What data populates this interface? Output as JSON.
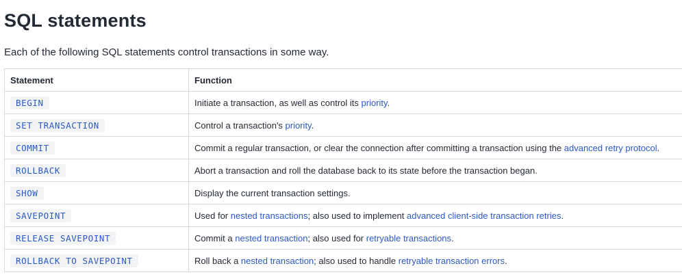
{
  "title": "SQL statements",
  "intro": "Each of the following SQL statements control transactions in some way.",
  "table": {
    "headers": [
      "Statement",
      "Function"
    ],
    "rows": [
      {
        "statement": "BEGIN",
        "parts": [
          {
            "text": "Initiate a transaction, as well as control its "
          },
          {
            "text": "priority",
            "link": true
          },
          {
            "text": "."
          }
        ]
      },
      {
        "statement": "SET TRANSACTION",
        "parts": [
          {
            "text": "Control a transaction's "
          },
          {
            "text": "priority",
            "link": true
          },
          {
            "text": "."
          }
        ]
      },
      {
        "statement": "COMMIT",
        "parts": [
          {
            "text": "Commit a regular transaction, or clear the connection after committing a transaction using the "
          },
          {
            "text": "advanced retry protocol",
            "link": true
          },
          {
            "text": "."
          }
        ]
      },
      {
        "statement": "ROLLBACK",
        "parts": [
          {
            "text": "Abort a transaction and roll the database back to its state before the transaction began."
          }
        ]
      },
      {
        "statement": "SHOW",
        "parts": [
          {
            "text": "Display the current transaction settings."
          }
        ]
      },
      {
        "statement": "SAVEPOINT",
        "parts": [
          {
            "text": "Used for "
          },
          {
            "text": "nested transactions",
            "link": true
          },
          {
            "text": "; also used to implement "
          },
          {
            "text": "advanced client-side transaction retries",
            "link": true
          },
          {
            "text": "."
          }
        ]
      },
      {
        "statement": "RELEASE SAVEPOINT",
        "parts": [
          {
            "text": "Commit a "
          },
          {
            "text": "nested transaction",
            "link": true
          },
          {
            "text": "; also used for "
          },
          {
            "text": "retryable transactions",
            "link": true
          },
          {
            "text": "."
          }
        ]
      },
      {
        "statement": "ROLLBACK TO SAVEPOINT",
        "parts": [
          {
            "text": "Roll back a "
          },
          {
            "text": "nested transaction",
            "link": true
          },
          {
            "text": "; also used to handle "
          },
          {
            "text": "retryable transaction errors",
            "link": true
          },
          {
            "text": "."
          }
        ]
      }
    ]
  }
}
